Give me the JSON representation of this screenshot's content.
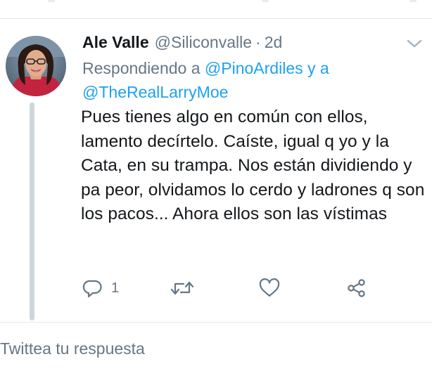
{
  "tweet": {
    "author_name": "Ale Valle",
    "author_handle": "@Siliconvalle",
    "separator": "·",
    "timestamp": "2d",
    "replying_prefix": "Respondiendo a",
    "replying_mentions": [
      "@PinoArdiles",
      "@TheRealLarryMoe"
    ],
    "replying_joiner": "y a",
    "text": "Pues tienes algo en común con ellos, lamento decírtelo. Caíste, igual q yo y la Cata, en su trampa. Nos están dividiendo y pa peor, olvidamos lo cerdo y ladrones q son los pacos... Ahora ellos son las vístimas",
    "reply_count": "1"
  },
  "icons": {
    "menu": "chevron-down-icon",
    "reply": "reply-icon",
    "retweet": "retweet-icon",
    "like": "heart-icon",
    "share": "share-icon"
  },
  "composer": {
    "placeholder": "Twittea tu respuesta"
  },
  "colors": {
    "text": "#14171a",
    "muted": "#657786",
    "link": "#1da1f2",
    "divider": "#e1e8ed",
    "thread_line": "#ccd6dd"
  }
}
